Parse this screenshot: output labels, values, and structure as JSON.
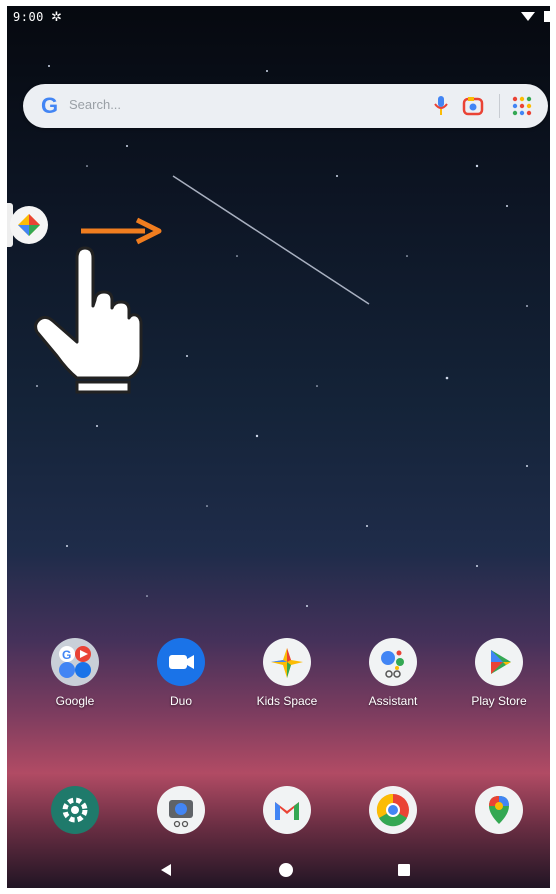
{
  "status_bar": {
    "time": "9:00",
    "icons": [
      "settings-gear-icon",
      "wifi-icon",
      "battery-icon"
    ]
  },
  "search": {
    "placeholder": "Search..."
  },
  "gesture": {
    "direction": "right",
    "accent_color": "#f07d1f"
  },
  "home_apps": [
    {
      "label": "Google",
      "icon": "google-folder-icon"
    },
    {
      "label": "Duo",
      "icon": "duo-icon"
    },
    {
      "label": "Kids Space",
      "icon": "kids-space-icon"
    },
    {
      "label": "Assistant",
      "icon": "assistant-icon"
    },
    {
      "label": "Play Store",
      "icon": "play-store-icon"
    }
  ],
  "dock_apps": [
    {
      "icon": "settings-icon"
    },
    {
      "icon": "camera-icon"
    },
    {
      "icon": "gmail-icon"
    },
    {
      "icon": "chrome-icon"
    },
    {
      "icon": "maps-icon"
    }
  ],
  "nav_bar": {
    "buttons": [
      "back",
      "home",
      "recents"
    ]
  }
}
